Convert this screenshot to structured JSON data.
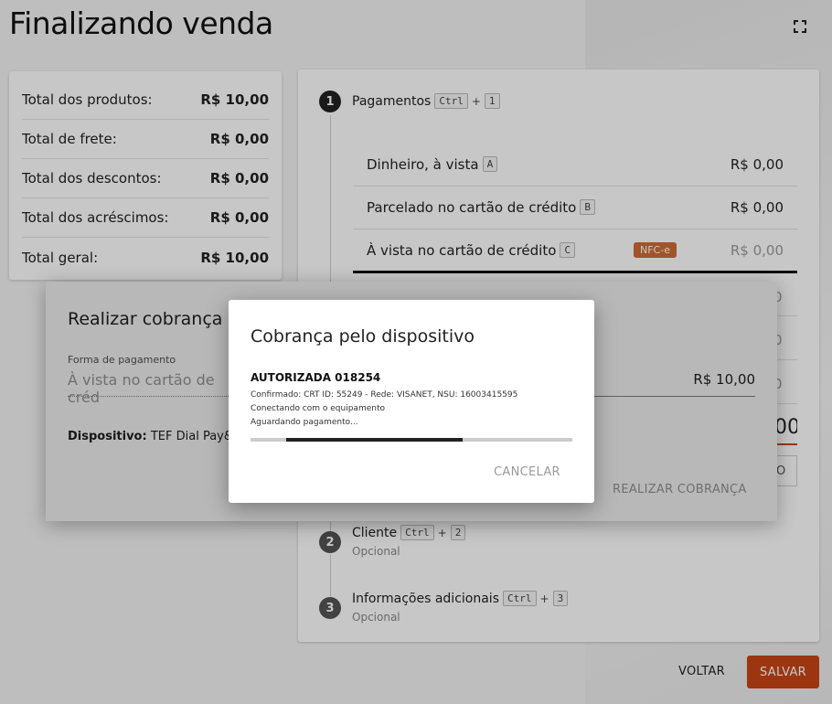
{
  "page": {
    "title": "Finalizando venda"
  },
  "totals": [
    {
      "label": "Total dos produtos:",
      "value": "R$ 10,00"
    },
    {
      "label": "Total de frete:",
      "value": "R$ 0,00"
    },
    {
      "label": "Total dos descontos:",
      "value": "R$ 0,00"
    },
    {
      "label": "Total dos acréscimos:",
      "value": "R$ 0,00"
    },
    {
      "label": "Total geral:",
      "value": "R$ 10,00"
    }
  ],
  "steps": {
    "payments": {
      "number": "1",
      "label": "Pagamentos",
      "key1": "Ctrl",
      "plus": "+",
      "key2": "1"
    },
    "client": {
      "number": "2",
      "label": "Cliente",
      "key1": "Ctrl",
      "plus": "+",
      "key2": "2",
      "sub": "Opcional"
    },
    "info": {
      "number": "3",
      "label": "Informações adicionais",
      "key1": "Ctrl",
      "plus": "+",
      "key2": "3",
      "sub": "Opcional"
    }
  },
  "payment_methods": [
    {
      "label": "Dinheiro, à vista",
      "key": "A",
      "value": "R$ 0,00"
    },
    {
      "label": "Parcelado no cartão de crédito",
      "key": "B",
      "value": "R$ 0,00"
    },
    {
      "label": "À vista no cartão de crédito",
      "key": "C",
      "value": "R$ 0,00",
      "badge": "NFC-e"
    }
  ],
  "peek": {
    "row1": "0",
    "row2": "0",
    "row3": "0",
    "total": "00",
    "btn": "O"
  },
  "charge_dialog": {
    "title": "Realizar cobrança p",
    "field_label": "Forma de pagamento",
    "field_value": "À vista no cartão de créd",
    "amount": "R$ 10,00",
    "device_label": "Dispositivo:",
    "device_value": "TEF Dial Pay&Ge",
    "action": "REALIZAR COBRANÇA"
  },
  "device_dialog": {
    "title": "Cobrança pelo dispositivo",
    "status": "AUTORIZADA 018254",
    "lines": [
      "Confirmado: CRT ID: 55249 - Rede: VISANET, NSU: 16003415595",
      "Conectando com o equipamento",
      "Aguardando pagamento..."
    ],
    "progress_start": 0.11,
    "progress_end": 0.66,
    "cancel": "CANCELAR"
  },
  "footer": {
    "back": "VOLTAR",
    "save": "SALVAR"
  },
  "colors": {
    "accent": "#c84616",
    "badge": "#d06b35"
  }
}
